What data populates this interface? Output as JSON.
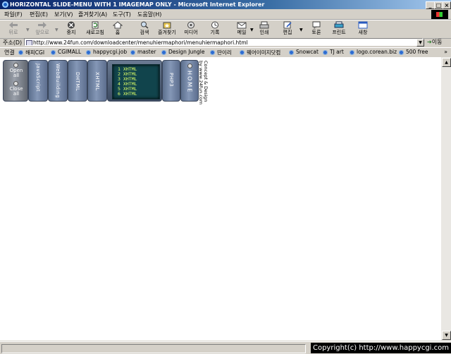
{
  "window": {
    "title": "HORIZONTAL SLIDE-MENU WITH 1 IMAGEMAP ONLY - Microsoft Internet Explorer",
    "min_glyph": "_",
    "max_glyph": "□",
    "close_glyph": "×"
  },
  "menu": {
    "items": [
      "파일(F)",
      "편집(E)",
      "보기(V)",
      "즐겨찾기(A)",
      "도구(T)",
      "도움말(H)"
    ]
  },
  "toolbar": {
    "items": [
      {
        "label": "뒤로",
        "icon": "back-arrow-icon",
        "disabled": true
      },
      {
        "label": "앞으로",
        "icon": "forward-arrow-icon",
        "disabled": true
      },
      {
        "label": "중지",
        "icon": "stop-icon"
      },
      {
        "label": "새로고침",
        "icon": "refresh-icon"
      },
      {
        "label": "홈",
        "icon": "home-icon"
      },
      {
        "label": "검색",
        "icon": "search-icon"
      },
      {
        "label": "즐겨찾기",
        "icon": "favorites-icon"
      },
      {
        "label": "미디어",
        "icon": "media-icon"
      },
      {
        "label": "기록",
        "icon": "history-icon"
      },
      {
        "label": "메일",
        "icon": "mail-icon"
      },
      {
        "label": "인쇄",
        "icon": "print-icon"
      },
      {
        "label": "편집",
        "icon": "edit-icon"
      },
      {
        "label": "토론",
        "icon": "discuss-icon"
      },
      {
        "label": "프린트",
        "icon": "printer-icon"
      },
      {
        "label": "새창",
        "icon": "new-window-icon"
      }
    ]
  },
  "address": {
    "label": "주소(D)",
    "url": "http://www.24fun.com/downloadcenter/menuhiermaphori/menuhiermaphori.html",
    "go": "이동"
  },
  "links": {
    "label": "연결",
    "items": [
      "해피CGI",
      "CGIMALL",
      "happycgi.job",
      "master",
      "Design Jungle",
      "딴이리",
      "웨어이미지닷컴",
      "Snowcat",
      "TJ art",
      "logo.corean.biz",
      "500 free"
    ],
    "more": "»"
  },
  "slidemenu": {
    "open_label": "Open\nall",
    "close_label": "Close\nall",
    "panels": [
      "JavaScript",
      "WebBuilding",
      "DHTML",
      "XHTML",
      "PHP3",
      "HOME"
    ],
    "xhtml_lines": [
      "1 XHTML",
      "2 XHTML",
      "3 XHTML",
      "4 XHTML",
      "5 XHTML",
      "6 XHTML"
    ],
    "credit_line1": "Concept & Design",
    "credit_line2": "by www.24fun.com"
  },
  "status": {
    "copyright": "Copyright(c) http://www.happycgi.com"
  }
}
